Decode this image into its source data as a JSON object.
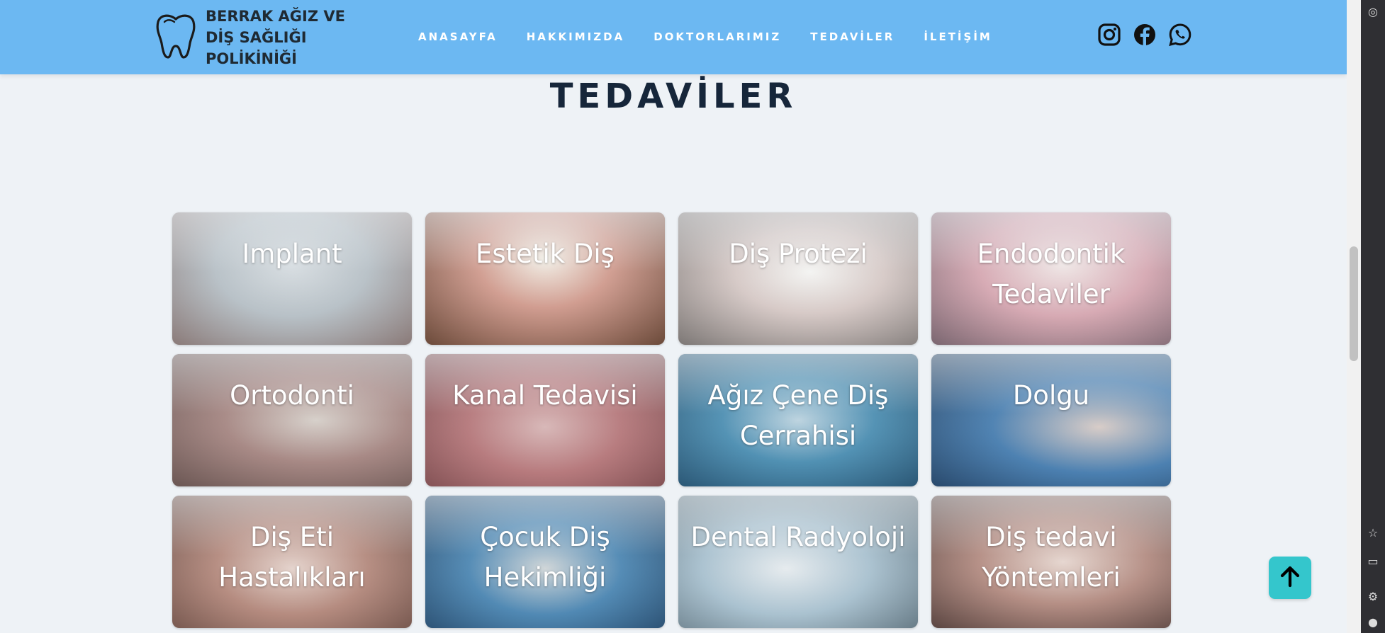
{
  "brand": {
    "name": "BERRAK AĞIZ VE DİŞ SAĞLIĞI POLİKİNİĞİ",
    "logo_icon": "tooth-icon"
  },
  "nav": {
    "items": [
      {
        "label": "ANASAYFA"
      },
      {
        "label": "HAKKIMIZDA"
      },
      {
        "label": "DOKTORLARIMIZ"
      },
      {
        "label": "TEDAVİLER"
      },
      {
        "label": "İLETİŞİM"
      }
    ]
  },
  "socials": [
    {
      "icon": "instagram-icon"
    },
    {
      "icon": "facebook-icon"
    },
    {
      "icon": "whatsapp-icon"
    }
  ],
  "section": {
    "title": "TEDAVİLER"
  },
  "treatments": [
    {
      "label": "Implant"
    },
    {
      "label": "Estetik Diş"
    },
    {
      "label": "Diş Protezi"
    },
    {
      "label": "Endodontik Tedaviler"
    },
    {
      "label": "Ortodonti"
    },
    {
      "label": "Kanal Tedavisi"
    },
    {
      "label": "Ağız Çene Diş Cerrahisi"
    },
    {
      "label": "Dolgu"
    },
    {
      "label": "Diş Eti Hastalıkları"
    },
    {
      "label": "Çocuk Diş Hekimliği"
    },
    {
      "label": "Dental Radyoloji"
    },
    {
      "label": "Diş tedavi Yöntemleri"
    }
  ],
  "scroll_top": {
    "icon": "arrow-up-icon"
  },
  "colors": {
    "header": "#6cb8f2",
    "background": "#eef2f6",
    "title": "#16263a",
    "scroll_button": "#34c6cc"
  }
}
